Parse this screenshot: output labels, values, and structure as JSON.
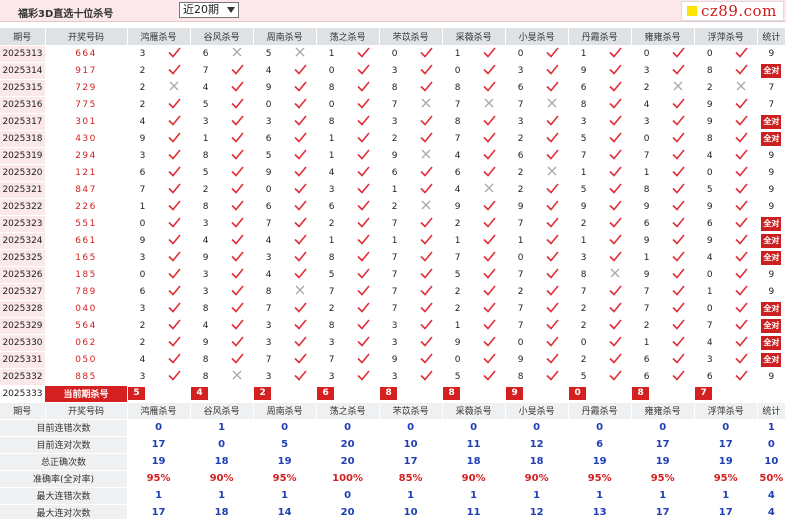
{
  "header": {
    "title": "福彩3D直选十位杀号",
    "period_select": "近20期",
    "logo_text": "cz89.com"
  },
  "columns": [
    "期号",
    "开奖号码",
    "鸿雁杀号",
    "谷风杀号",
    "周南杀号",
    "荡之杀号",
    "芣苡杀号",
    "采薇杀号",
    "小旻杀号",
    "丹霞杀号",
    "雍雍杀号",
    "浮萍杀号",
    "统计"
  ],
  "rows": [
    {
      "issue": "2025313",
      "code": "664",
      "picks": [
        [
          3,
          1
        ],
        [
          6,
          0
        ],
        [
          5,
          0
        ],
        [
          1,
          1
        ],
        [
          0,
          1
        ],
        [
          1,
          1
        ],
        [
          0,
          1
        ],
        [
          1,
          1
        ],
        [
          0,
          1
        ],
        [
          0,
          1
        ]
      ],
      "stat": "9"
    },
    {
      "issue": "2025314",
      "code": "917",
      "picks": [
        [
          2,
          1
        ],
        [
          7,
          1
        ],
        [
          4,
          1
        ],
        [
          0,
          1
        ],
        [
          3,
          1
        ],
        [
          0,
          1
        ],
        [
          3,
          1
        ],
        [
          9,
          1
        ],
        [
          3,
          1
        ],
        [
          8,
          1
        ]
      ],
      "stat": "全对"
    },
    {
      "issue": "2025315",
      "code": "729",
      "picks": [
        [
          2,
          0
        ],
        [
          4,
          1
        ],
        [
          9,
          1
        ],
        [
          8,
          1
        ],
        [
          8,
          1
        ],
        [
          8,
          1
        ],
        [
          6,
          1
        ],
        [
          6,
          1
        ],
        [
          2,
          0
        ],
        [
          2,
          0
        ]
      ],
      "stat": "7"
    },
    {
      "issue": "2025316",
      "code": "775",
      "picks": [
        [
          2,
          1
        ],
        [
          5,
          1
        ],
        [
          0,
          1
        ],
        [
          0,
          1
        ],
        [
          7,
          0
        ],
        [
          7,
          0
        ],
        [
          7,
          0
        ],
        [
          8,
          1
        ],
        [
          4,
          1
        ],
        [
          9,
          1
        ]
      ],
      "stat": "7"
    },
    {
      "issue": "2025317",
      "code": "301",
      "picks": [
        [
          4,
          1
        ],
        [
          3,
          1
        ],
        [
          3,
          1
        ],
        [
          8,
          1
        ],
        [
          3,
          1
        ],
        [
          8,
          1
        ],
        [
          3,
          1
        ],
        [
          3,
          1
        ],
        [
          3,
          1
        ],
        [
          9,
          1
        ]
      ],
      "stat": "全对"
    },
    {
      "issue": "2025318",
      "code": "430",
      "picks": [
        [
          9,
          1
        ],
        [
          1,
          1
        ],
        [
          6,
          1
        ],
        [
          1,
          1
        ],
        [
          2,
          1
        ],
        [
          7,
          1
        ],
        [
          2,
          1
        ],
        [
          5,
          1
        ],
        [
          0,
          1
        ],
        [
          8,
          1
        ]
      ],
      "stat": "全对"
    },
    {
      "issue": "2025319",
      "code": "294",
      "picks": [
        [
          3,
          1
        ],
        [
          8,
          1
        ],
        [
          5,
          1
        ],
        [
          1,
          1
        ],
        [
          9,
          0
        ],
        [
          4,
          1
        ],
        [
          6,
          1
        ],
        [
          7,
          1
        ],
        [
          7,
          1
        ],
        [
          4,
          1
        ]
      ],
      "stat": "9"
    },
    {
      "issue": "2025320",
      "code": "121",
      "picks": [
        [
          6,
          1
        ],
        [
          5,
          1
        ],
        [
          9,
          1
        ],
        [
          4,
          1
        ],
        [
          6,
          1
        ],
        [
          6,
          1
        ],
        [
          2,
          0
        ],
        [
          1,
          1
        ],
        [
          1,
          1
        ],
        [
          0,
          1
        ]
      ],
      "stat": "9"
    },
    {
      "issue": "2025321",
      "code": "847",
      "picks": [
        [
          7,
          1
        ],
        [
          2,
          1
        ],
        [
          0,
          1
        ],
        [
          3,
          1
        ],
        [
          1,
          1
        ],
        [
          4,
          0
        ],
        [
          2,
          1
        ],
        [
          5,
          1
        ],
        [
          8,
          1
        ],
        [
          5,
          1
        ]
      ],
      "stat": "9"
    },
    {
      "issue": "2025322",
      "code": "226",
      "picks": [
        [
          1,
          1
        ],
        [
          8,
          1
        ],
        [
          6,
          1
        ],
        [
          6,
          1
        ],
        [
          2,
          0
        ],
        [
          9,
          1
        ],
        [
          9,
          1
        ],
        [
          9,
          1
        ],
        [
          9,
          1
        ],
        [
          9,
          1
        ]
      ],
      "stat": "9"
    },
    {
      "issue": "2025323",
      "code": "551",
      "picks": [
        [
          0,
          1
        ],
        [
          3,
          1
        ],
        [
          7,
          1
        ],
        [
          2,
          1
        ],
        [
          7,
          1
        ],
        [
          2,
          1
        ],
        [
          7,
          1
        ],
        [
          2,
          1
        ],
        [
          6,
          1
        ],
        [
          6,
          1
        ]
      ],
      "stat": "全对"
    },
    {
      "issue": "2025324",
      "code": "661",
      "picks": [
        [
          9,
          1
        ],
        [
          4,
          1
        ],
        [
          4,
          1
        ],
        [
          1,
          1
        ],
        [
          1,
          1
        ],
        [
          1,
          1
        ],
        [
          1,
          1
        ],
        [
          1,
          1
        ],
        [
          9,
          1
        ],
        [
          9,
          1
        ]
      ],
      "stat": "全对"
    },
    {
      "issue": "2025325",
      "code": "165",
      "picks": [
        [
          3,
          1
        ],
        [
          9,
          1
        ],
        [
          3,
          1
        ],
        [
          8,
          1
        ],
        [
          7,
          1
        ],
        [
          7,
          1
        ],
        [
          0,
          1
        ],
        [
          3,
          1
        ],
        [
          1,
          1
        ],
        [
          4,
          1
        ]
      ],
      "stat": "全对"
    },
    {
      "issue": "2025326",
      "code": "185",
      "picks": [
        [
          0,
          1
        ],
        [
          3,
          1
        ],
        [
          4,
          1
        ],
        [
          5,
          1
        ],
        [
          7,
          1
        ],
        [
          5,
          1
        ],
        [
          7,
          1
        ],
        [
          8,
          0
        ],
        [
          9,
          1
        ],
        [
          0,
          1
        ]
      ],
      "stat": "9"
    },
    {
      "issue": "2025327",
      "code": "789",
      "picks": [
        [
          6,
          1
        ],
        [
          3,
          1
        ],
        [
          8,
          0
        ],
        [
          7,
          1
        ],
        [
          7,
          1
        ],
        [
          2,
          1
        ],
        [
          2,
          1
        ],
        [
          7,
          1
        ],
        [
          7,
          1
        ],
        [
          1,
          1
        ]
      ],
      "stat": "9"
    },
    {
      "issue": "2025328",
      "code": "040",
      "picks": [
        [
          3,
          1
        ],
        [
          8,
          1
        ],
        [
          7,
          1
        ],
        [
          2,
          1
        ],
        [
          7,
          1
        ],
        [
          2,
          1
        ],
        [
          7,
          1
        ],
        [
          2,
          1
        ],
        [
          7,
          1
        ],
        [
          0,
          1
        ]
      ],
      "stat": "全对"
    },
    {
      "issue": "2025329",
      "code": "564",
      "picks": [
        [
          2,
          1
        ],
        [
          4,
          1
        ],
        [
          3,
          1
        ],
        [
          8,
          1
        ],
        [
          3,
          1
        ],
        [
          1,
          1
        ],
        [
          7,
          1
        ],
        [
          2,
          1
        ],
        [
          2,
          1
        ],
        [
          7,
          1
        ]
      ],
      "stat": "全对"
    },
    {
      "issue": "2025330",
      "code": "062",
      "picks": [
        [
          2,
          1
        ],
        [
          9,
          1
        ],
        [
          3,
          1
        ],
        [
          3,
          1
        ],
        [
          3,
          1
        ],
        [
          9,
          1
        ],
        [
          0,
          1
        ],
        [
          0,
          1
        ],
        [
          1,
          1
        ],
        [
          4,
          1
        ]
      ],
      "stat": "全对"
    },
    {
      "issue": "2025331",
      "code": "050",
      "picks": [
        [
          4,
          1
        ],
        [
          8,
          1
        ],
        [
          7,
          1
        ],
        [
          7,
          1
        ],
        [
          9,
          1
        ],
        [
          0,
          1
        ],
        [
          9,
          1
        ],
        [
          2,
          1
        ],
        [
          6,
          1
        ],
        [
          3,
          1
        ]
      ],
      "stat": "全对"
    },
    {
      "issue": "2025332",
      "code": "885",
      "picks": [
        [
          3,
          1
        ],
        [
          8,
          0
        ],
        [
          3,
          1
        ],
        [
          3,
          1
        ],
        [
          3,
          1
        ],
        [
          5,
          1
        ],
        [
          8,
          1
        ],
        [
          5,
          1
        ],
        [
          6,
          1
        ],
        [
          6,
          1
        ]
      ],
      "stat": "9"
    }
  ],
  "current": {
    "issue": "2025333",
    "label": "当前期杀号",
    "picks": [
      "5",
      "4",
      "2",
      "6",
      "8",
      "8",
      "9",
      "0",
      "8",
      "7"
    ]
  },
  "stats": [
    {
      "label": "目前连错次数",
      "values": [
        "0",
        "1",
        "0",
        "0",
        "0",
        "0",
        "0",
        "0",
        "0",
        "0",
        "1"
      ]
    },
    {
      "label": "目前连对次数",
      "values": [
        "17",
        "0",
        "5",
        "20",
        "10",
        "11",
        "12",
        "6",
        "17",
        "17",
        "0"
      ]
    },
    {
      "label": "总正确次数",
      "values": [
        "19",
        "18",
        "19",
        "20",
        "17",
        "18",
        "18",
        "19",
        "19",
        "19",
        "10"
      ]
    },
    {
      "label": "准确率(全对率)",
      "values": [
        "95%",
        "90%",
        "95%",
        "100%",
        "85%",
        "90%",
        "90%",
        "95%",
        "95%",
        "95%",
        "50%"
      ]
    },
    {
      "label": "最大连错次数",
      "values": [
        "1",
        "1",
        "1",
        "0",
        "1",
        "1",
        "1",
        "1",
        "1",
        "1",
        "4"
      ]
    },
    {
      "label": "最大连对次数",
      "values": [
        "17",
        "18",
        "14",
        "20",
        "10",
        "11",
        "12",
        "13",
        "17",
        "17",
        "4"
      ]
    }
  ],
  "colors": {
    "accent": "#d42020",
    "check": "#e0303a",
    "cross": "#a8a8a8",
    "stat_blue": "#1f3fb4",
    "header_bg": "#dfe2e4",
    "issue_bg": "#fbe8ea"
  }
}
